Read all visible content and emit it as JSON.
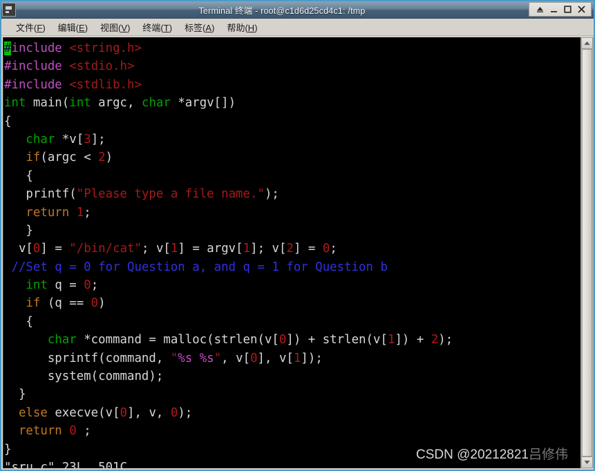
{
  "window": {
    "title": "Terminal 终端 - root@c1d6d25cd4c1: /tmp",
    "border_color": "#4a9cc8",
    "titlebar_color": "#3d586e",
    "controls": [
      {
        "name": "shade-button",
        "label": "▲"
      },
      {
        "name": "minimize-button",
        "label": "_"
      },
      {
        "name": "maximize-button",
        "label": "□"
      },
      {
        "name": "close-button",
        "label": "✕"
      }
    ]
  },
  "menubar": {
    "items": [
      {
        "text": "文件",
        "accel": "F"
      },
      {
        "text": "编辑",
        "accel": "E"
      },
      {
        "text": "视图",
        "accel": "V"
      },
      {
        "text": "终端",
        "accel": "T"
      },
      {
        "text": "标签",
        "accel": "A"
      },
      {
        "text": "帮助",
        "accel": "H"
      }
    ]
  },
  "terminal": {
    "background": "#000000",
    "foreground": "#d8d8d8",
    "cursor_color": "#00c000",
    "editor": "vim",
    "status_line": "\"sru.c\" 23L, 501C",
    "file_name": "sru.c",
    "line_count": "23L",
    "byte_count": "501C",
    "code_lines": [
      "#include <string.h>",
      "#include <stdio.h>",
      "#include <stdlib.h>",
      "int main(int argc, char *argv[])",
      "{",
      "   char *v[3];",
      "   if(argc < 2)",
      "   {",
      "   printf(\"Please type a file name.\");",
      "   return 1;",
      "   }",
      "  v[0] = \"/bin/cat\"; v[1] = argv[1]; v[2] = 0;",
      " //Set q = 0 for Question a, and q = 1 for Question b",
      "   int q = 0;",
      "   if (q == 0)",
      "   {",
      "      char *command = malloc(strlen(v[0]) + strlen(v[1]) + 2);",
      "      sprintf(command, \"%s %s\", v[0], v[1]);",
      "      system(command);",
      "  }",
      "  else execve(v[0], v, 0);",
      "  return 0 ;",
      "}"
    ]
  },
  "watermark": {
    "prefix": "CSDN @20212821",
    "author": "吕修伟"
  },
  "scrollbar": {
    "up_arrow": "▲",
    "down_arrow": "▼"
  }
}
